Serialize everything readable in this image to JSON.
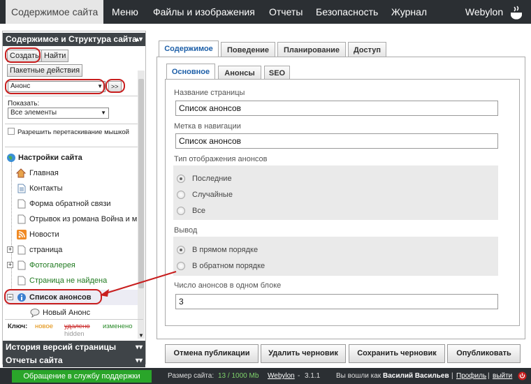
{
  "nav": {
    "tabs": [
      "Содержимое сайта",
      "Меню",
      "Файлы и изображения",
      "Отчеты",
      "Безопасность",
      "Журнал"
    ],
    "brand": "Webylon"
  },
  "sidebar": {
    "title": "Содержимое и Структура сайта",
    "create": "Создать",
    "find": "Найти",
    "batch": "Пакетные действия",
    "type_select": "Анонс",
    "go": ">>",
    "show_label": "Показать:",
    "show_select": "Все элементы",
    "drag_label": "Разрешить перетаскивание мышкой",
    "tree": [
      {
        "label": "Настройки сайта",
        "icon": "globe-icon"
      },
      {
        "label": "Главная",
        "icon": "home-icon"
      },
      {
        "label": "Контакты",
        "icon": "page-icon"
      },
      {
        "label": "Форма обратной связи",
        "icon": "page-icon"
      },
      {
        "label": "Отрывок из романа Война и м",
        "icon": "page-icon"
      },
      {
        "label": "Новости",
        "icon": "rss-icon"
      },
      {
        "label": "страница",
        "icon": "page-icon"
      },
      {
        "label": "Фотогалерея",
        "icon": "page-icon"
      },
      {
        "label": "Страница не найдена",
        "icon": "page-icon"
      },
      {
        "label": "Список анонсов",
        "icon": "info-icon"
      },
      {
        "label": "Новый Анонс",
        "icon": "comment-icon"
      }
    ],
    "legend": {
      "key": "Ключ:",
      "new": "новое",
      "deleted": "удалено",
      "changed": "изменено",
      "hidden": "hidden"
    },
    "history": "История версий страницы",
    "reports": "Отчеты сайта"
  },
  "main": {
    "tabs": [
      "Содержимое",
      "Поведение",
      "Планирование",
      "Доступ"
    ],
    "subtabs": [
      "Основное",
      "Анонсы",
      "SEO"
    ],
    "page_name_label": "Название страницы",
    "page_name": "Список анонсов",
    "nav_label_label": "Метка в навигации",
    "nav_label": "Список анонсов",
    "display_type_label": "Тип отображения анонсов",
    "display_options": [
      "Последние",
      "Случайные",
      "Все"
    ],
    "output_label": "Вывод",
    "output_options": [
      "В прямом порядке",
      "В обратном порядке"
    ],
    "count_label": "Число анонсов в одном блоке",
    "count_value": "3"
  },
  "actions": [
    "Отмена публикации",
    "Удалить черновик",
    "Сохранить черновик",
    "Опубликовать"
  ],
  "footer": {
    "support": "Обращение в службу поддержки",
    "size_label": "Размер сайта:",
    "size_value": "13 / 1000 Mb",
    "product": "Webylon",
    "version": "3.1.1",
    "logged_in": "Вы вошли как",
    "user": "Василий Васильев",
    "profile": "Профиль",
    "logout": "выйти"
  },
  "colors": {
    "nav_bg": "#2b2f33",
    "accent_red": "#c81e1e",
    "support_green": "#2aa52a",
    "tab_active": "#1d5fa8"
  }
}
